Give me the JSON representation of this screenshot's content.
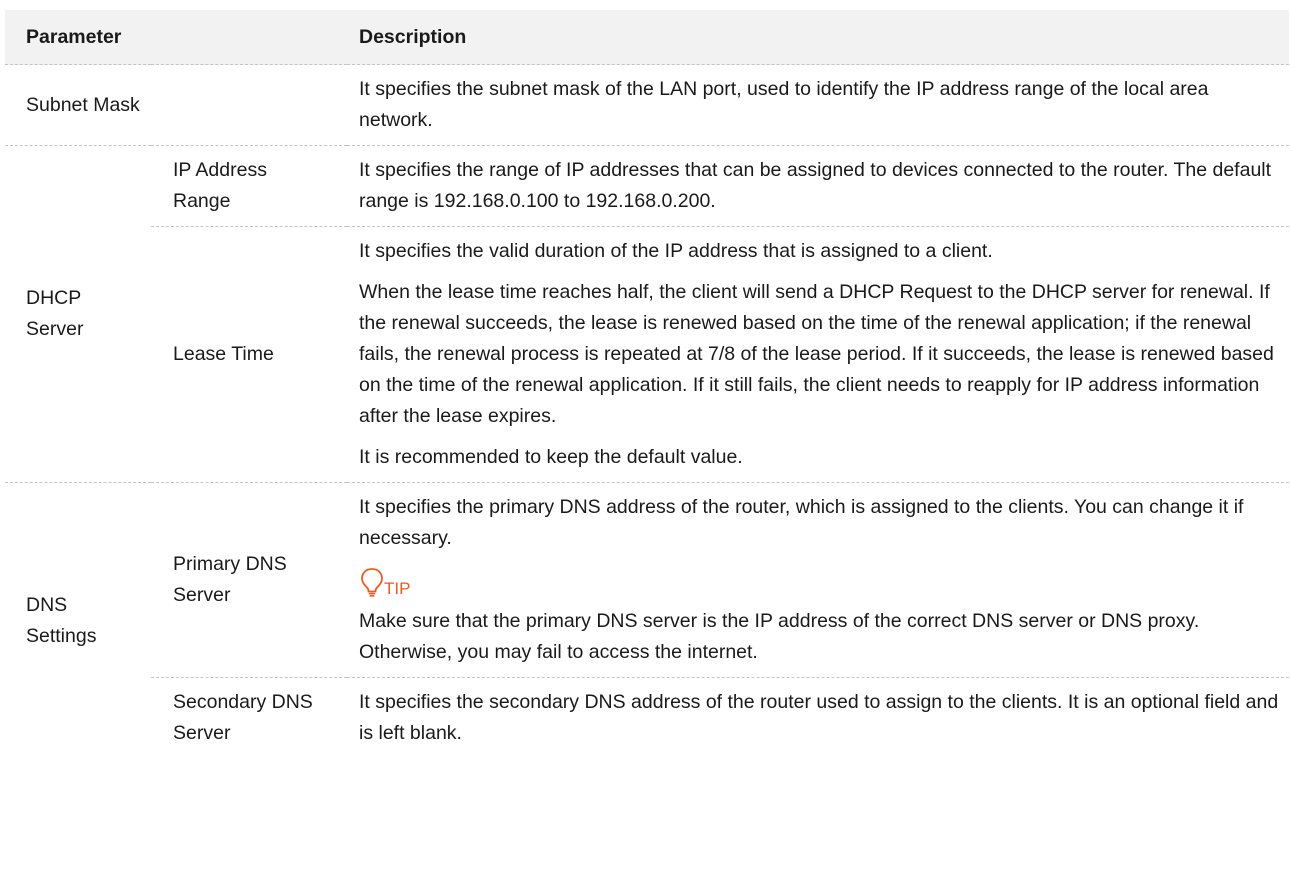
{
  "header": {
    "parameter": "Parameter",
    "description": "Description"
  },
  "rows": {
    "subnet_mask": {
      "name": "Subnet Mask",
      "description": "It specifies the subnet mask of the LAN port, used to identify the IP address range of the local area network."
    },
    "dhcp_server": {
      "name": "DHCP Server",
      "ip_address_range": {
        "name": "IP Address Range",
        "description": "It specifies the range of IP addresses that can be assigned to devices connected to the router. The default range is 192.168.0.100 to 192.168.0.200."
      },
      "lease_time": {
        "name": "Lease Time",
        "paragraphs": [
          "It specifies the valid duration of the IP address that is assigned to a client.",
          "When the lease time reaches half, the client will send a DHCP Request to the DHCP server for renewal. If the renewal succeeds, the lease is renewed based on the time of the renewal application; if the renewal fails, the renewal process is repeated at 7/8 of the lease period. If it succeeds, the lease is renewed based on the time of the renewal application. If it still fails, the client needs to reapply for IP address information after the lease expires.",
          "It is recommended to keep the default value."
        ]
      }
    },
    "dns_settings": {
      "name": "DNS Settings",
      "primary_dns": {
        "name": "Primary DNS Server",
        "description": "It specifies the primary DNS address of the router, which is assigned to the clients. You can change it if necessary.",
        "tip_label": "TIP",
        "tip_text": "Make sure that the primary DNS server is the IP address of the correct DNS server or DNS proxy. Otherwise, you may fail to access the internet."
      },
      "secondary_dns": {
        "name": "Secondary DNS Server",
        "description": "It specifies the secondary DNS address of the router used to assign to the clients. It is an optional field and is left blank."
      }
    }
  },
  "colors": {
    "tip_accent": "#ee5a24",
    "header_bg": "#f2f2f2",
    "divider": "#c4c4c4"
  },
  "icons": {
    "tip": "lightbulb-icon"
  }
}
